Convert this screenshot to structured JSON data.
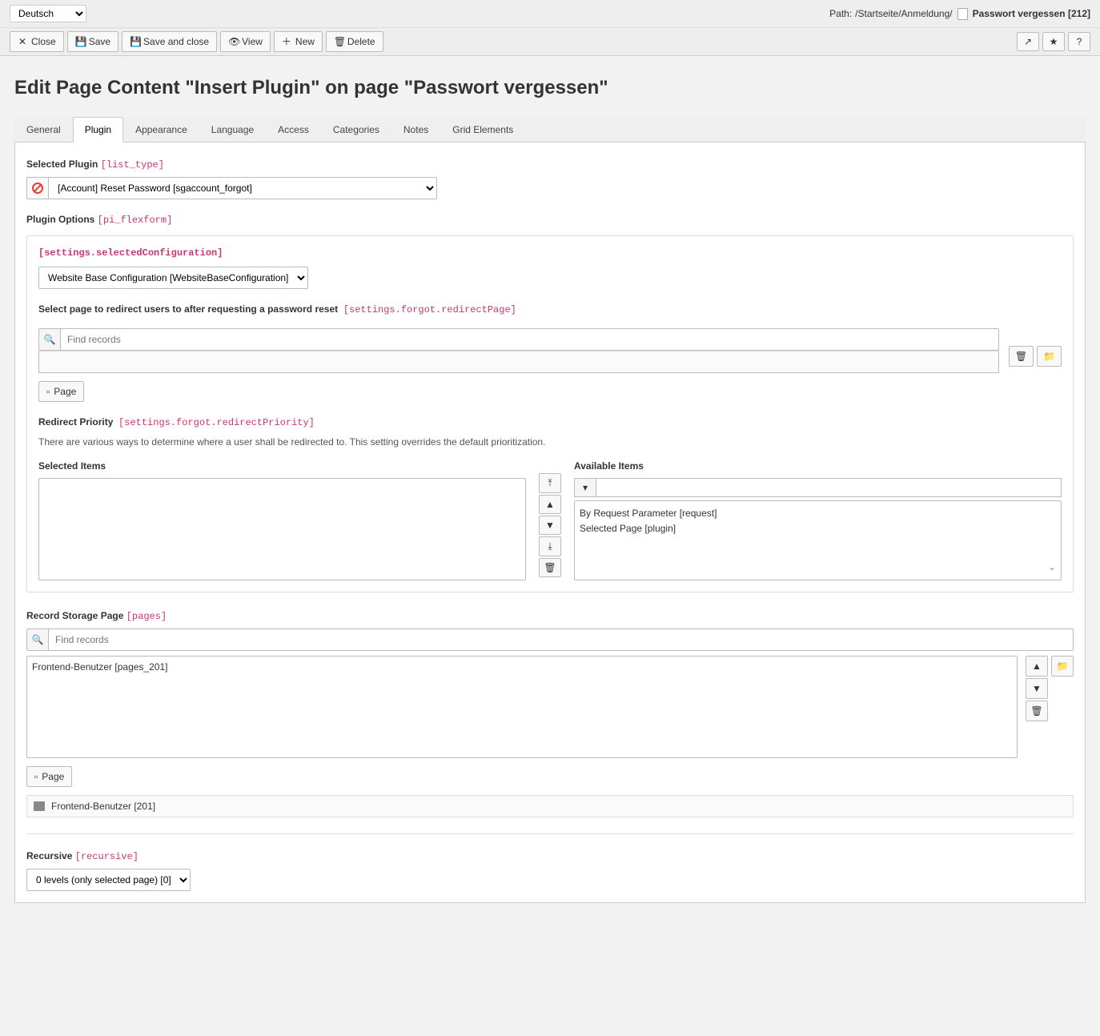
{
  "lang_select": "Deutsch",
  "path_label": "Path: ",
  "path_crumbs": "/Startseite/Anmeldung/",
  "path_page": "Passwort vergessen [212]",
  "toolbar": {
    "close": "Close",
    "save": "Save",
    "save_close": "Save and close",
    "view": "View",
    "new": "New",
    "delete": "Delete",
    "help": "?"
  },
  "page_title": "Edit Page Content \"Insert Plugin\" on page \"Passwort vergessen\"",
  "tabs": [
    "General",
    "Plugin",
    "Appearance",
    "Language",
    "Access",
    "Categories",
    "Notes",
    "Grid Elements"
  ],
  "active_tab": "Plugin",
  "selected_plugin_label": "Selected Plugin",
  "selected_plugin_code": "[list_type]",
  "selected_plugin_value": "[Account] Reset Password [sgaccount_forgot]",
  "plugin_options_label": "Plugin Options",
  "plugin_options_code": "[pi_flexform]",
  "settings_conf_code": "[settings.selectedConfiguration]",
  "settings_conf_value": "Website Base Configuration [WebsiteBaseConfiguration]",
  "redirect_page_label": "Select page to redirect users to after requesting a password reset",
  "redirect_page_code": "[settings.forgot.redirectPage]",
  "find_records_placeholder": "Find records",
  "page_btn": "Page",
  "redirect_priority_label": "Redirect Priority",
  "redirect_priority_code": "[settings.forgot.redirectPriority]",
  "redirect_priority_help": "There are various ways to determine where a user shall be redirected to. This setting overrides the default prioritization.",
  "selected_items_label": "Selected Items",
  "available_items_label": "Available Items",
  "available_items": [
    "By Request Parameter [request]",
    "Selected Page [plugin]"
  ],
  "record_storage_label": "Record Storage Page",
  "record_storage_code": "[pages]",
  "record_items": [
    "Frontend-Benutzer [pages_201]"
  ],
  "record_readonly": "Frontend-Benutzer [201]",
  "recursive_label": "Recursive",
  "recursive_code": "[recursive]",
  "recursive_value": "0 levels (only selected page) [0]"
}
